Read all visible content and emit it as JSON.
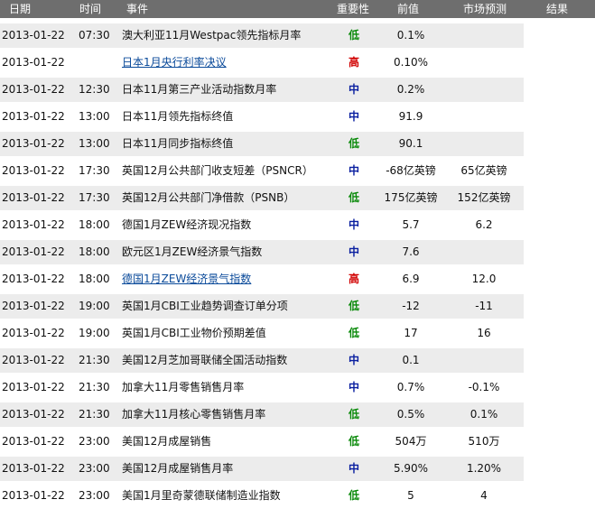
{
  "header": {
    "date": "日期",
    "time": "时间",
    "event": "事件",
    "importance": "重要性",
    "previous": "前值",
    "forecast": "市场预测",
    "result": "结果"
  },
  "colors": {
    "header_bg": "#6e6e6e",
    "row_shade": "#ececec",
    "low": "#0a8a0a",
    "medium": "#0a1fa0",
    "high": "#d10000",
    "link": "#0a4a9a"
  },
  "rows": [
    {
      "date": "2013-01-22",
      "time": "07:30",
      "event": "澳大利亚11月Westpac领先指标月率",
      "importance": "低",
      "level": "low",
      "previous": "0.1%",
      "forecast": "",
      "result": "",
      "link": false
    },
    {
      "date": "2013-01-22",
      "time": "",
      "event": "日本1月央行利率决议",
      "importance": "高",
      "level": "high",
      "previous": "0.10%",
      "forecast": "",
      "result": "",
      "link": true
    },
    {
      "date": "2013-01-22",
      "time": "12:30",
      "event": "日本11月第三产业活动指数月率",
      "importance": "中",
      "level": "mid",
      "previous": "0.2%",
      "forecast": "",
      "result": "",
      "link": false
    },
    {
      "date": "2013-01-22",
      "time": "13:00",
      "event": "日本11月领先指标终值",
      "importance": "中",
      "level": "mid",
      "previous": "91.9",
      "forecast": "",
      "result": "",
      "link": false
    },
    {
      "date": "2013-01-22",
      "time": "13:00",
      "event": "日本11月同步指标终值",
      "importance": "低",
      "level": "low",
      "previous": "90.1",
      "forecast": "",
      "result": "",
      "link": false
    },
    {
      "date": "2013-01-22",
      "time": "17:30",
      "event": "英国12月公共部门收支短差（PSNCR）",
      "importance": "中",
      "level": "mid",
      "previous": "-68亿英镑",
      "forecast": "65亿英镑",
      "result": "",
      "link": false
    },
    {
      "date": "2013-01-22",
      "time": "17:30",
      "event": "英国12月公共部门净借款（PSNB）",
      "importance": "低",
      "level": "low",
      "previous": "175亿英镑",
      "forecast": "152亿英镑",
      "result": "",
      "link": false
    },
    {
      "date": "2013-01-22",
      "time": "18:00",
      "event": "德国1月ZEW经济现况指数",
      "importance": "中",
      "level": "mid",
      "previous": "5.7",
      "forecast": "6.2",
      "result": "",
      "link": false
    },
    {
      "date": "2013-01-22",
      "time": "18:00",
      "event": "欧元区1月ZEW经济景气指数",
      "importance": "中",
      "level": "mid",
      "previous": "7.6",
      "forecast": "",
      "result": "",
      "link": false
    },
    {
      "date": "2013-01-22",
      "time": "18:00",
      "event": "德国1月ZEW经济景气指数",
      "importance": "高",
      "level": "high",
      "previous": "6.9",
      "forecast": "12.0",
      "result": "",
      "link": true
    },
    {
      "date": "2013-01-22",
      "time": "19:00",
      "event": "英国1月CBI工业趋势调查订单分项",
      "importance": "低",
      "level": "low",
      "previous": "-12",
      "forecast": "-11",
      "result": "",
      "link": false
    },
    {
      "date": "2013-01-22",
      "time": "19:00",
      "event": "英国1月CBI工业物价预期差值",
      "importance": "低",
      "level": "low",
      "previous": "17",
      "forecast": "16",
      "result": "",
      "link": false
    },
    {
      "date": "2013-01-22",
      "time": "21:30",
      "event": "美国12月芝加哥联储全国活动指数",
      "importance": "中",
      "level": "mid",
      "previous": "0.1",
      "forecast": "",
      "result": "",
      "link": false
    },
    {
      "date": "2013-01-22",
      "time": "21:30",
      "event": "加拿大11月零售销售月率",
      "importance": "中",
      "level": "mid",
      "previous": "0.7%",
      "forecast": "-0.1%",
      "result": "",
      "link": false
    },
    {
      "date": "2013-01-22",
      "time": "21:30",
      "event": "加拿大11月核心零售销售月率",
      "importance": "低",
      "level": "low",
      "previous": "0.5%",
      "forecast": "0.1%",
      "result": "",
      "link": false
    },
    {
      "date": "2013-01-22",
      "time": "23:00",
      "event": "美国12月成屋销售",
      "importance": "低",
      "level": "low",
      "previous": "504万",
      "forecast": "510万",
      "result": "",
      "link": false
    },
    {
      "date": "2013-01-22",
      "time": "23:00",
      "event": "美国12月成屋销售月率",
      "importance": "中",
      "level": "mid",
      "previous": "5.90%",
      "forecast": "1.20%",
      "result": "",
      "link": false
    },
    {
      "date": "2013-01-22",
      "time": "23:00",
      "event": "美国1月里奇蒙德联储制造业指数",
      "importance": "低",
      "level": "low",
      "previous": "5",
      "forecast": "4",
      "result": "",
      "link": false
    }
  ]
}
